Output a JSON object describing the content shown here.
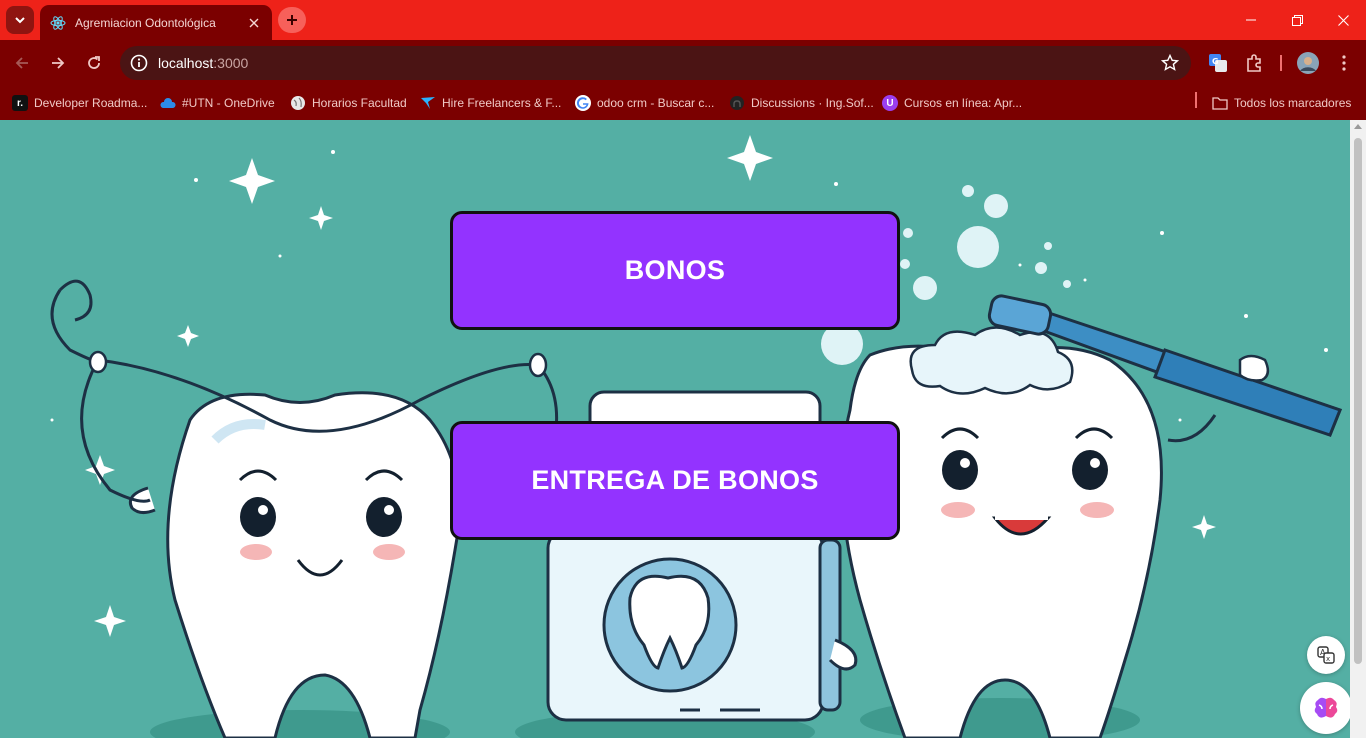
{
  "browser": {
    "tab_title": "Agremiacion Odontológica",
    "url_host": "localhost",
    "url_port": ":3000",
    "bookmarks": [
      "Developer Roadma...",
      "#UTN - OneDrive",
      "Horarios Facultad",
      "Hire Freelancers & F...",
      "odoo crm - Buscar c...",
      "Discussions · Ing.Sof...",
      "Cursos en línea: Apr...",
      "Todos los marcadores"
    ],
    "colors": {
      "titlebar": "#ee2219",
      "toolbar": "#7b0000"
    }
  },
  "page": {
    "buttons": {
      "bonos": "BONOS",
      "entrega": "ENTREGA DE BONOS"
    },
    "button_color": "#9333ff",
    "background_color": "#54afa4"
  }
}
